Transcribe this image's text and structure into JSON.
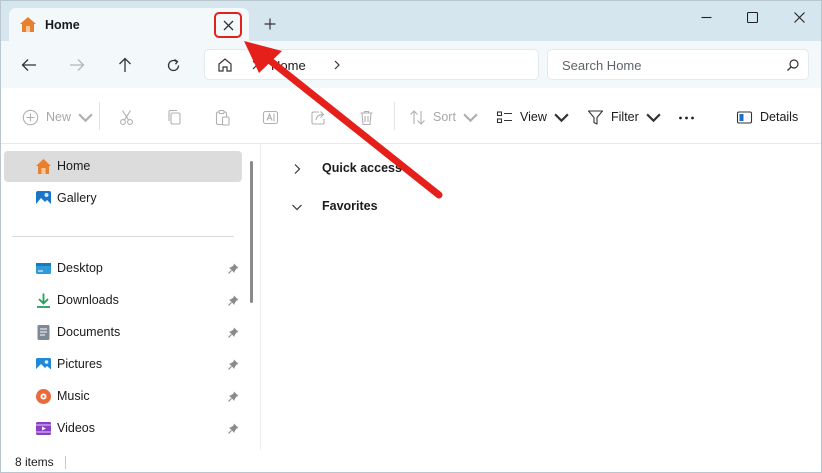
{
  "colors": {
    "titlebar_bg": "#d6e6ee",
    "tab_bg": "#f3f8fa",
    "accent_red": "#e5201a",
    "selected_bg": "#dcdcdc",
    "home_icon_orange": "#e8812f"
  },
  "tab": {
    "title": "Home",
    "icon": "home-icon",
    "close_icon": "close-icon",
    "new_tab_icon": "plus-icon"
  },
  "window_controls": [
    "minimize-icon",
    "maximize-icon",
    "close-icon"
  ],
  "address": {
    "nav_icons": [
      "back-arrow-icon",
      "forward-arrow-icon",
      "up-arrow-icon",
      "refresh-icon"
    ],
    "crumb": "Home",
    "search_placeholder": "Search Home"
  },
  "commands": {
    "new": "New",
    "sort": "Sort",
    "view": "View",
    "filter": "Filter",
    "details": "Details",
    "disabled_icons": [
      "cut-icon",
      "copy-icon",
      "paste-icon",
      "rename-icon",
      "share-icon",
      "delete-icon"
    ]
  },
  "sidebar": {
    "items": [
      {
        "label": "Home",
        "icon": "home-icon",
        "selected": true,
        "pinned": false
      },
      {
        "label": "Gallery",
        "icon": "gallery-icon",
        "selected": false,
        "pinned": false
      },
      {
        "label": "Desktop",
        "icon": "desktop-icon",
        "selected": false,
        "pinned": true
      },
      {
        "label": "Downloads",
        "icon": "downloads-icon",
        "selected": false,
        "pinned": true
      },
      {
        "label": "Documents",
        "icon": "documents-icon",
        "selected": false,
        "pinned": true
      },
      {
        "label": "Pictures",
        "icon": "pictures-icon",
        "selected": false,
        "pinned": true
      },
      {
        "label": "Music",
        "icon": "music-icon",
        "selected": false,
        "pinned": true
      },
      {
        "label": "Videos",
        "icon": "videos-icon",
        "selected": false,
        "pinned": true
      }
    ]
  },
  "content": {
    "sections": [
      {
        "label": "Quick access",
        "expanded": false
      },
      {
        "label": "Favorites",
        "expanded": true
      }
    ]
  },
  "status": {
    "item_count": "8 items"
  }
}
